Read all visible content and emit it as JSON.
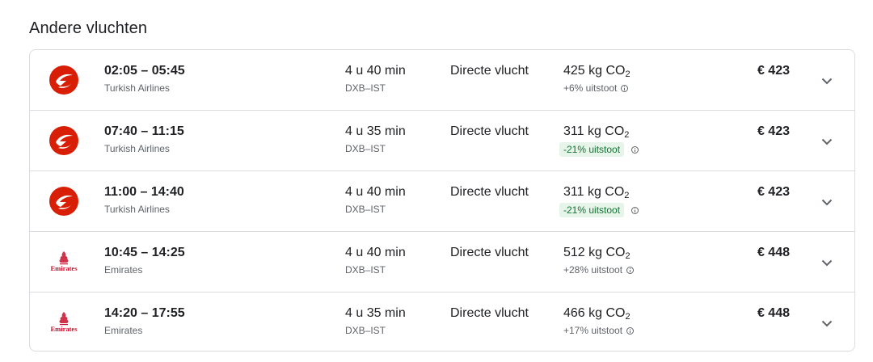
{
  "section": {
    "title": "Andere vluchten"
  },
  "colors": {
    "turkish_red": "#d81e05",
    "emirates_red": "#c8102e",
    "good_badge_bg": "#e6f4ea",
    "good_badge_text": "#137333"
  },
  "flights": [
    {
      "times": "02:05 – 05:45",
      "airline": "Turkish Airlines",
      "logo": "turkish-airlines-logo",
      "duration": "4 u 40 min",
      "route": "DXB–IST",
      "stops": "Directe vlucht",
      "co2_value": "425 kg CO",
      "co2_sub": "2",
      "emissions": "+6% uitstoot",
      "emissions_good": false,
      "price": "€ 423"
    },
    {
      "times": "07:40 – 11:15",
      "airline": "Turkish Airlines",
      "logo": "turkish-airlines-logo",
      "duration": "4 u 35 min",
      "route": "DXB–IST",
      "stops": "Directe vlucht",
      "co2_value": "311 kg CO",
      "co2_sub": "2",
      "emissions": "-21% uitstoot",
      "emissions_good": true,
      "price": "€ 423"
    },
    {
      "times": "11:00 – 14:40",
      "airline": "Turkish Airlines",
      "logo": "turkish-airlines-logo",
      "duration": "4 u 40 min",
      "route": "DXB–IST",
      "stops": "Directe vlucht",
      "co2_value": "311 kg CO",
      "co2_sub": "2",
      "emissions": "-21% uitstoot",
      "emissions_good": true,
      "price": "€ 423"
    },
    {
      "times": "10:45 – 14:25",
      "airline": "Emirates",
      "logo": "emirates-logo",
      "duration": "4 u 40 min",
      "route": "DXB–IST",
      "stops": "Directe vlucht",
      "co2_value": "512 kg CO",
      "co2_sub": "2",
      "emissions": "+28% uitstoot",
      "emissions_good": false,
      "price": "€ 448"
    },
    {
      "times": "14:20 – 17:55",
      "airline": "Emirates",
      "logo": "emirates-logo",
      "duration": "4 u 35 min",
      "route": "DXB–IST",
      "stops": "Directe vlucht",
      "co2_value": "466 kg CO",
      "co2_sub": "2",
      "emissions": "+17% uitstoot",
      "emissions_good": false,
      "price": "€ 448"
    }
  ]
}
